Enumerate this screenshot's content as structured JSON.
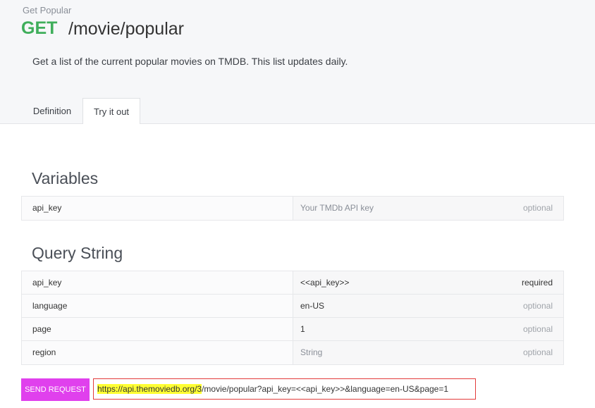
{
  "header": {
    "eyebrow": "Get Popular",
    "method": "GET",
    "path": "/movie/popular",
    "description": "Get a list of the current popular movies on TMDB. This list updates daily."
  },
  "tabs": {
    "definition": "Definition",
    "try_it_out": "Try it out",
    "active": "try_it_out"
  },
  "variables": {
    "title": "Variables",
    "rows": [
      {
        "name": "api_key",
        "value": "Your TMDb API key",
        "placeholder": true,
        "requirement": "optional"
      }
    ]
  },
  "query_string": {
    "title": "Query String",
    "rows": [
      {
        "name": "api_key",
        "value": "<<api_key>>",
        "placeholder": false,
        "requirement": "required"
      },
      {
        "name": "language",
        "value": "en-US",
        "placeholder": false,
        "requirement": "optional"
      },
      {
        "name": "page",
        "value": "1",
        "placeholder": false,
        "requirement": "optional"
      },
      {
        "name": "region",
        "value": "String",
        "placeholder": true,
        "requirement": "optional"
      }
    ]
  },
  "request": {
    "send_label": "SEND REQUEST",
    "url_highlighted": "https://api.themoviedb.org/3",
    "url_rest": "/movie/popular?api_key=<<api_key>>&language=en-US&page=1"
  },
  "colors": {
    "method_green": "#3fae5b",
    "send_button": "#e040ed",
    "url_border": "#e33a3a",
    "url_highlight": "#ffff33"
  }
}
